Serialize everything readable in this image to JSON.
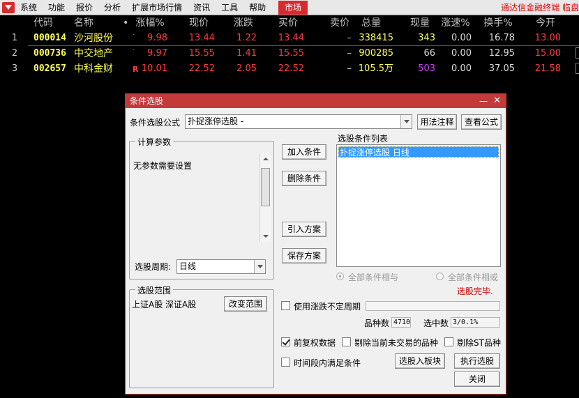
{
  "menubar": {
    "items": [
      "系统",
      "功能",
      "报价",
      "分析",
      "扩展市场行情",
      "资讯",
      "工具",
      "帮助"
    ],
    "active": "市场",
    "brand": "通达信金融终端 临盘"
  },
  "table": {
    "headers": {
      "code": "代码",
      "name": "名称",
      "dot": "•",
      "pct": "涨幅%",
      "price": "现价",
      "chg": "涨跌",
      "buy": "买价",
      "sell": "卖价",
      "vol": "总量",
      "cur": "现量",
      "speed": "涨速%",
      "turn": "换手%",
      "open": "今开"
    },
    "rows": [
      {
        "idx": "1",
        "code": "000014",
        "name": "沙河股份",
        "mark": "·",
        "pct": "9.98",
        "price": "13.44",
        "chg": "1.22",
        "buy": "13.44",
        "sell": "–",
        "vol": "338415",
        "cur": "343",
        "speed": "0.00",
        "turn": "16.78",
        "open": "13.00"
      },
      {
        "idx": "2",
        "code": "000736",
        "name": "中交地产",
        "mark": "·",
        "pct": "9.97",
        "price": "15.55",
        "chg": "1.41",
        "buy": "15.55",
        "sell": "–",
        "vol": "900285",
        "cur": "66",
        "speed": "0.00",
        "turn": "12.95",
        "open": "15.00"
      },
      {
        "idx": "3",
        "code": "002657",
        "name": "中科金财",
        "mark": "R",
        "pct": "10.01",
        "price": "22.52",
        "chg": "2.05",
        "buy": "22.52",
        "sell": "–",
        "vol": "105.5万",
        "cur": "503",
        "speed": "0.00",
        "turn": "37.05",
        "open": "21.58"
      }
    ]
  },
  "dialog": {
    "title": "条件选股",
    "minimize": "—",
    "close": "✕",
    "formula_label": "条件选股公式",
    "formula_value": "扑捉涨停选股 -",
    "usage_button": "用法注释",
    "view_formula_button": "查看公式",
    "params_group": "计算参数",
    "params_text": "无参数需要设置",
    "period_label": "选股周期:",
    "period_value": "日线",
    "add_button": "加入条件",
    "delete_button": "删除条件",
    "import_button": "引入方案",
    "save_button": "保存方案",
    "conditions_label": "选股条件列表",
    "conditions": [
      "扑捉涨停选股  日线"
    ],
    "radio_and": "全部条件相与",
    "radio_or": "全部条件相或",
    "status": "选股完毕.",
    "scope_group": "选股范围",
    "scope_text": "上证A股 深证A股",
    "change_scope_button": "改变范围",
    "use_uncertain_period": "使用涨跌不定周期",
    "count_label": "品种数",
    "count_value": "4710",
    "selected_label": "选中数",
    "selected_value": "3/0.1%",
    "adj_label": "前复权数据",
    "exclude_untraded": "剔除当前未交易的品种",
    "exclude_st": "剔除ST品种",
    "time_condition": "时间段内满足条件",
    "to_block_button": "选股入板块",
    "execute_button": "执行选股",
    "close_button": "关闭",
    "colors": {
      "titlebar": "#c23a3a",
      "status": "#cc0000"
    }
  }
}
